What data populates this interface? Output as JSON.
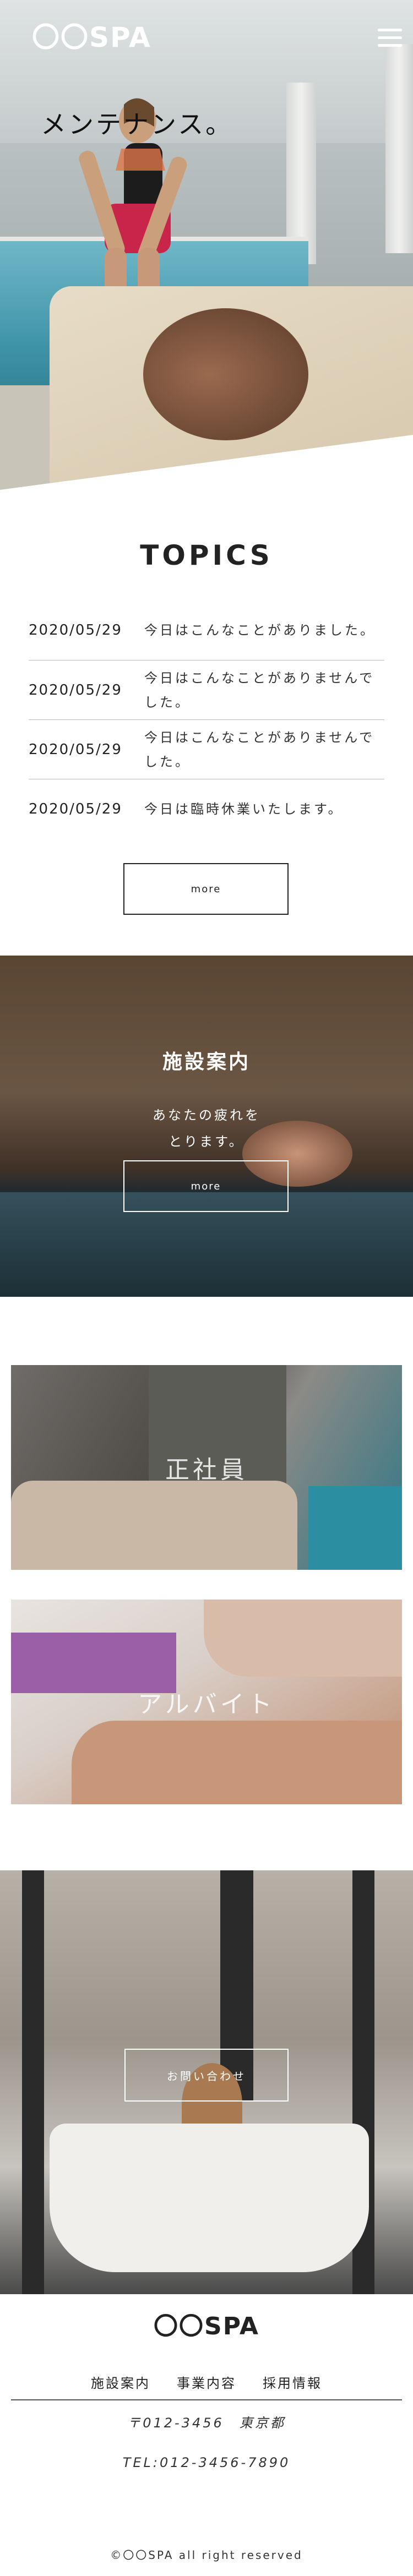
{
  "header": {
    "logo": "〇〇SPA",
    "catch": "メンテナンス。"
  },
  "topics": {
    "title": "TOPICS",
    "items": [
      {
        "date": "2020/05/29",
        "text": "今日はこんなことがありました。"
      },
      {
        "date": "2020/05/29",
        "text": "今日はこんなことがありませんでした。"
      },
      {
        "date": "2020/05/29",
        "text": "今日はこんなことがありませんでした。"
      },
      {
        "date": "2020/05/29",
        "text": "今日は臨時休業いたします。"
      }
    ],
    "more_label": "more"
  },
  "facility": {
    "title": "施設案内",
    "sub_line1": "あなたの疲れを",
    "sub_line2": "とります。",
    "more_label": "more"
  },
  "recruit": {
    "fulltime_label": "正社員",
    "parttime_label": "アルバイト"
  },
  "contact": {
    "button_label": "お問い合わせ"
  },
  "footer": {
    "logo": "〇〇SPA",
    "nav": [
      "施設案内",
      "事業内容",
      "採用情報"
    ],
    "address": "〒012-3456　東京都",
    "tel": "TEL:012-3456-7890",
    "copyright": "©〇〇SPA all right reserved"
  }
}
